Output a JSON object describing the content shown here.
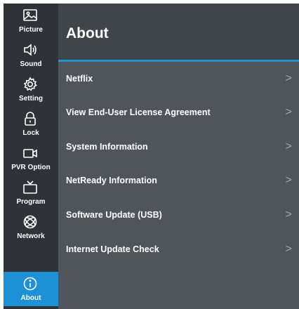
{
  "sidebar": {
    "items": [
      {
        "label": "Picture",
        "icon": "picture-icon"
      },
      {
        "label": "Sound",
        "icon": "speaker-icon"
      },
      {
        "label": "Setting",
        "icon": "gear-icon"
      },
      {
        "label": "Lock",
        "icon": "lock-icon"
      },
      {
        "label": "PVR Option",
        "icon": "video-camera-icon"
      },
      {
        "label": "Program",
        "icon": "tv-icon"
      },
      {
        "label": "Network",
        "icon": "globe-icon"
      },
      {
        "label": "About",
        "icon": "info-icon",
        "active": true
      }
    ]
  },
  "header": {
    "title": "About"
  },
  "menu": {
    "items": [
      {
        "label": "Netflix"
      },
      {
        "label": "View End-User License Agreement"
      },
      {
        "label": "System Information"
      },
      {
        "label": "NetReady Information"
      },
      {
        "label": "Software Update (USB)"
      },
      {
        "label": "Internet Update Check"
      }
    ],
    "chevron": ">"
  },
  "colors": {
    "accent": "#1e90d6",
    "sidebar_bg": "#2f3338",
    "panel_bg": "#4f555b",
    "header_bg": "#3f454b"
  }
}
